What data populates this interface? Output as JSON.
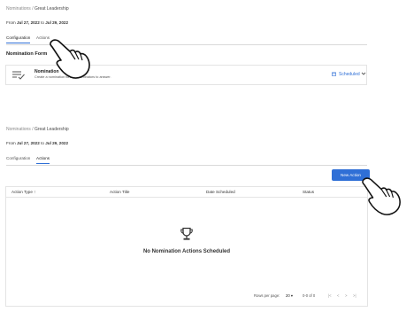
{
  "breadcrumb": {
    "root": "Nominations",
    "separator": "/",
    "current": "Great Leadership"
  },
  "date_range": {
    "prefix": "From",
    "start": "Jul 27, 2022",
    "joiner": "to",
    "end": "Jul 29, 2022"
  },
  "tabs": [
    {
      "label": "Configuration"
    },
    {
      "label": "Actions"
    }
  ],
  "top_panel": {
    "active_tab": "Configuration"
  },
  "bottom_panel": {
    "active_tab": "Actions"
  },
  "form_section": {
    "title": "Nomination Form",
    "card_name": "Nomination",
    "card_description": "Create a nomination form for nominators to answer.",
    "status": "Scheduled"
  },
  "actions": {
    "new_button": "New Action",
    "columns": [
      "Action Type",
      "Action Title",
      "Date Scheduled",
      "Status"
    ],
    "sort_indicator": "↑",
    "empty_message": "No Nomination Actions Scheduled",
    "pagination": {
      "rows_label": "Rows per page:",
      "rows_value": "20",
      "range": "0-0 of 0",
      "first": "|<",
      "prev": "<",
      "next": ">",
      "last": ">|"
    }
  },
  "colors": {
    "accent": "#2f6fd6",
    "border": "#e4e4e4"
  },
  "icons": [
    "list-check-icon",
    "calendar-icon",
    "chevron-down-icon",
    "trophy-icon",
    "pointer-hand-icon",
    "sort-arrow-icon"
  ]
}
